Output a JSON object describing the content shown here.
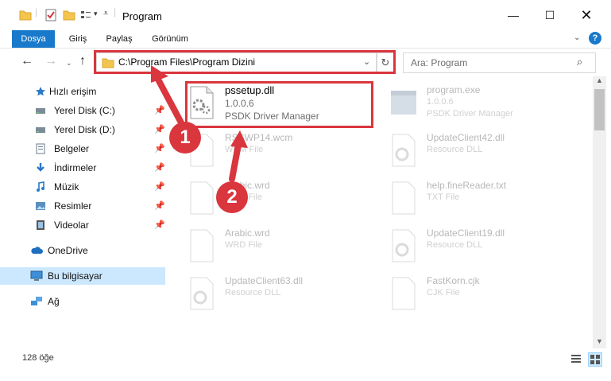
{
  "window": {
    "title": "Program"
  },
  "ribbon": {
    "tabs": [
      "Dosya",
      "Giriş",
      "Paylaş",
      "Görünüm"
    ]
  },
  "address": {
    "path": "C:\\Program Files\\Program Dizini"
  },
  "search": {
    "placeholder": "Ara: Program"
  },
  "sidebar": {
    "items": [
      {
        "label": "Hızlı erişim",
        "icon": "star-icon"
      },
      {
        "label": "Yerel Disk (C:)",
        "icon": "drive-icon"
      },
      {
        "label": "Yerel Disk (D:)",
        "icon": "drive-icon"
      },
      {
        "label": "Belgeler",
        "icon": "documents-icon"
      },
      {
        "label": "İndirmeler",
        "icon": "download-icon"
      },
      {
        "label": "Müzik",
        "icon": "music-icon"
      },
      {
        "label": "Resimler",
        "icon": "pictures-icon"
      },
      {
        "label": "Videolar",
        "icon": "videos-icon"
      },
      {
        "label": "OneDrive",
        "icon": "cloud-icon"
      },
      {
        "label": "Bu bilgisayar",
        "icon": "computer-icon"
      },
      {
        "label": "Ağ",
        "icon": "network-icon"
      }
    ]
  },
  "files": {
    "focus": {
      "name": "pssetup.dll",
      "version": "1.0.0.6",
      "desc": "PSDK Driver Manager"
    },
    "others": [
      {
        "name": "program.exe",
        "version": "1.0.0.6",
        "desc": "PSDK Driver Manager"
      },
      {
        "name": "RSSWP14.wcm",
        "version": "",
        "desc": "WCM File"
      },
      {
        "name": "UpdateClient42.dll",
        "version": "",
        "desc": "Resource DLL"
      },
      {
        "name": "Arabic.wrd",
        "version": "",
        "desc": "WRD File"
      },
      {
        "name": "help.fineReader.txt",
        "version": "",
        "desc": "TXT File"
      },
      {
        "name": "Arabic.wrd",
        "version": "",
        "desc": "WRD File"
      },
      {
        "name": "UpdateClient19.dll",
        "version": "",
        "desc": "Resource DLL"
      },
      {
        "name": "UpdateClient63.dll",
        "version": "",
        "desc": "Resource DLL"
      },
      {
        "name": "FastKorn.cjk",
        "version": "",
        "desc": "CJK File"
      }
    ]
  },
  "status": {
    "count": "128 öğe"
  },
  "annotations": {
    "one": "1",
    "two": "2"
  },
  "colors": {
    "accent": "#1979ca",
    "highlight": "#d9363e",
    "selected": "#cce8ff"
  }
}
